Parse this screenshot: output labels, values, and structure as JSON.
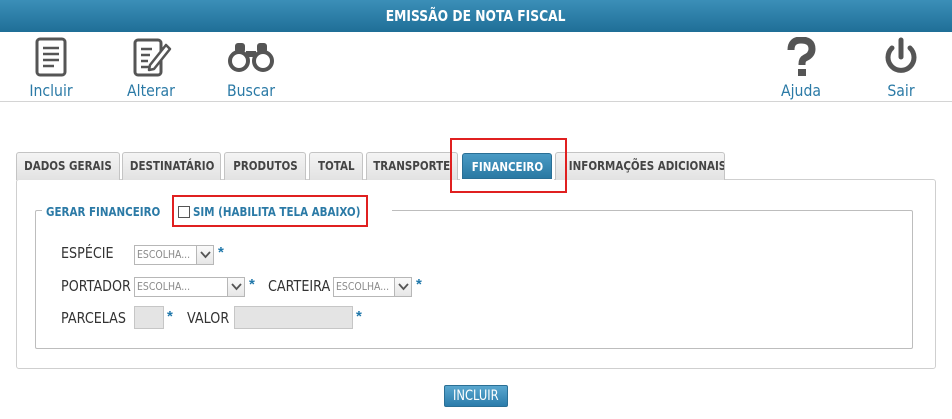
{
  "window": {
    "title": "EMISSÃO DE NOTA FISCAL"
  },
  "toolbar": {
    "incluir": "Incluir",
    "alterar": "Alterar",
    "buscar": "Buscar",
    "ajuda": "Ajuda",
    "sair": "Sair"
  },
  "tabs": [
    {
      "label": "DADOS GERAIS"
    },
    {
      "label": "DESTINATÁRIO"
    },
    {
      "label": "PRODUTOS"
    },
    {
      "label": "TOTAL"
    },
    {
      "label": "TRANSPORTE"
    },
    {
      "label": "FINANCEIRO",
      "active": true
    },
    {
      "label": "INFORMAÇÕES ADICIONAIS"
    }
  ],
  "financeiro": {
    "legend": "GERAR FINANCEIRO",
    "checkbox_label": "SIM (HABILITA TELA ABAIXO)",
    "checkbox_checked": false,
    "especie_label": "ESPÉCIE",
    "especie_value": "ESCOLHA...",
    "portador_label": "PORTADOR",
    "portador_value": "ESCOLHA...",
    "carteira_label": "CARTEIRA",
    "carteira_value": "ESCOLHA...",
    "parcelas_label": "PARCELAS",
    "parcelas_value": "",
    "valor_label": "VALOR",
    "valor_value": "",
    "required_mark": "*"
  },
  "footer": {
    "submit_label": "INCLUIR"
  },
  "colors": {
    "accent": "#2b7aa6",
    "titlebar": "#2a7ca6",
    "highlight": "#e02020"
  }
}
